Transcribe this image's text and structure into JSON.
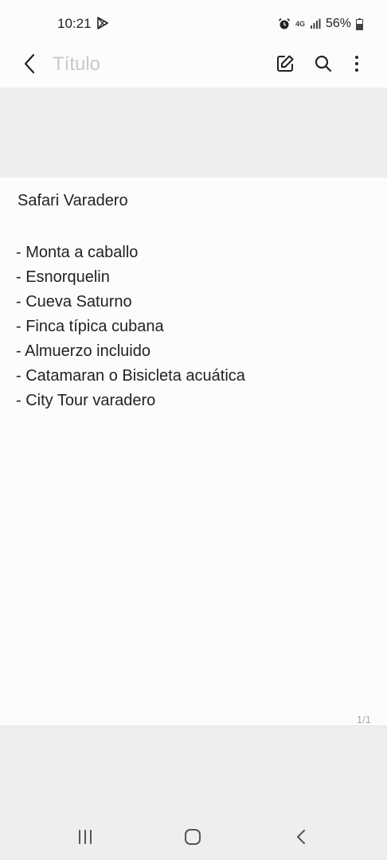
{
  "status_bar": {
    "time": "10:21",
    "network": "4G",
    "battery": "56%"
  },
  "app_bar": {
    "title_placeholder": "Título"
  },
  "note": {
    "heading": "Safari Varadero",
    "items": [
      "- Monta a caballo",
      "- Esnorquelin",
      "- Cueva Saturno",
      "- Finca típica cubana",
      "- Almuerzo incluido",
      "- Catamaran o Bisicleta acuática",
      "- City Tour varadero"
    ],
    "page_counter": "1/1"
  },
  "icons": {
    "back": "back-arrow-icon",
    "edit": "edit-icon",
    "search": "search-icon",
    "more": "more-vertical-icon",
    "play_store": "play-store-icon",
    "alarm": "alarm-icon",
    "signal": "signal-icon",
    "battery": "battery-icon"
  }
}
